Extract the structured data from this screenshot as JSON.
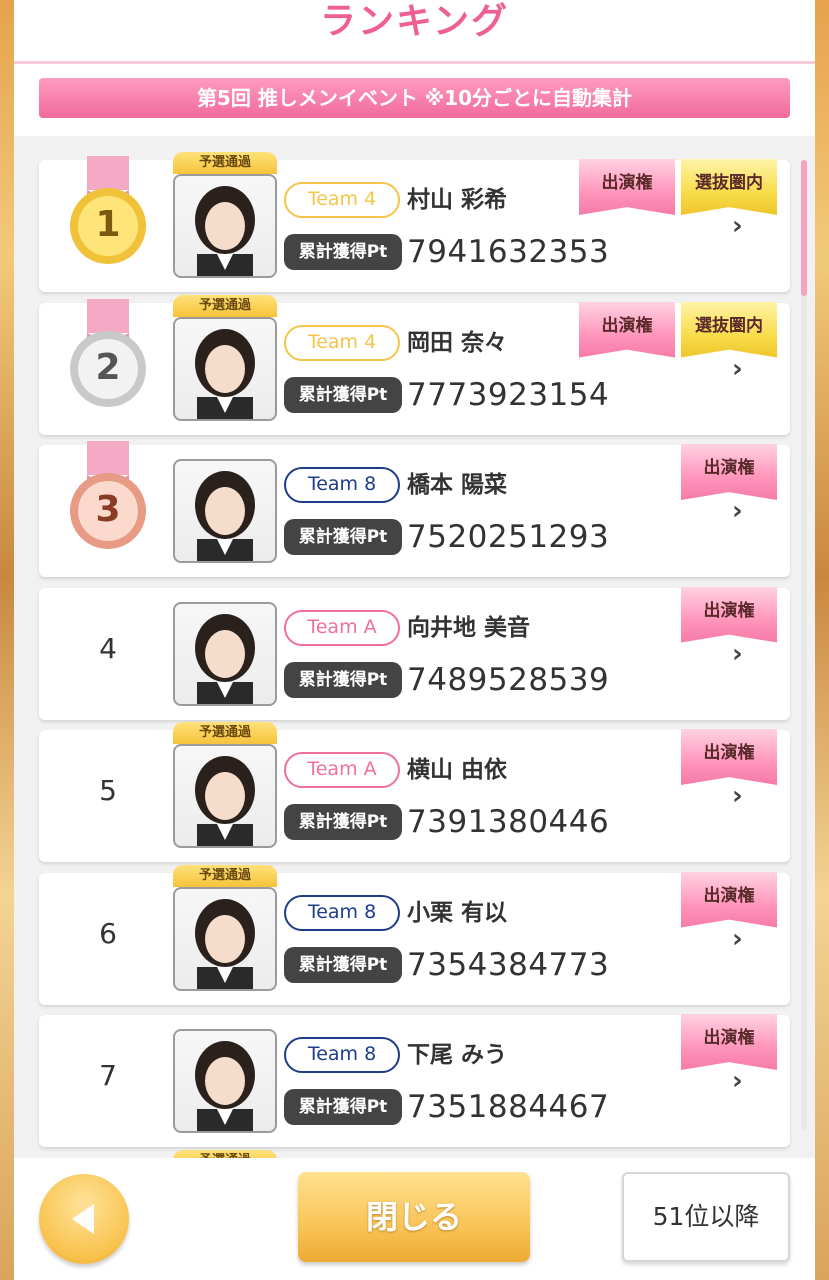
{
  "header": {
    "title": "ランキング"
  },
  "banner": {
    "text": "第5回 推しメンイベント ※10分ごとに自動集計"
  },
  "labels": {
    "qualify": "予選通過",
    "pt_label": "累計獲得Pt",
    "appearance": "出演権",
    "selected": "選抜圏内"
  },
  "colors": {
    "team4": "#f4c54a",
    "team8": "#1f3c88",
    "teamA": "#ef6f9f",
    "accent_pink": "#ef5f93"
  },
  "rows": [
    {
      "rank": "1",
      "medal": "gold",
      "qualified": true,
      "team": "Team 4",
      "team_color": "#f4c54a",
      "name": "村山 彩希",
      "points": "7941632353",
      "appearance": true,
      "selected": true
    },
    {
      "rank": "2",
      "medal": "silver",
      "qualified": true,
      "team": "Team 4",
      "team_color": "#f4c54a",
      "name": "岡田 奈々",
      "points": "7773923154",
      "appearance": true,
      "selected": true
    },
    {
      "rank": "3",
      "medal": "bronze",
      "qualified": false,
      "team": "Team 8",
      "team_color": "#1f3c88",
      "name": "橋本 陽菜",
      "points": "7520251293",
      "appearance": true,
      "selected": false
    },
    {
      "rank": "4",
      "medal": null,
      "qualified": false,
      "team": "Team A",
      "team_color": "#ef6f9f",
      "name": "向井地 美音",
      "points": "7489528539",
      "appearance": true,
      "selected": false
    },
    {
      "rank": "5",
      "medal": null,
      "qualified": true,
      "team": "Team A",
      "team_color": "#ef6f9f",
      "name": "横山 由依",
      "points": "7391380446",
      "appearance": true,
      "selected": false
    },
    {
      "rank": "6",
      "medal": null,
      "qualified": true,
      "team": "Team 8",
      "team_color": "#1f3c88",
      "name": "小栗 有以",
      "points": "7354384773",
      "appearance": true,
      "selected": false
    },
    {
      "rank": "7",
      "medal": null,
      "qualified": false,
      "team": "Team 8",
      "team_color": "#1f3c88",
      "name": "下尾 みう",
      "points": "7351884467",
      "appearance": true,
      "selected": false
    }
  ],
  "footer": {
    "back_icon": "triangle-left-icon",
    "close_label": "閉じる",
    "next_label": "51位以降"
  }
}
